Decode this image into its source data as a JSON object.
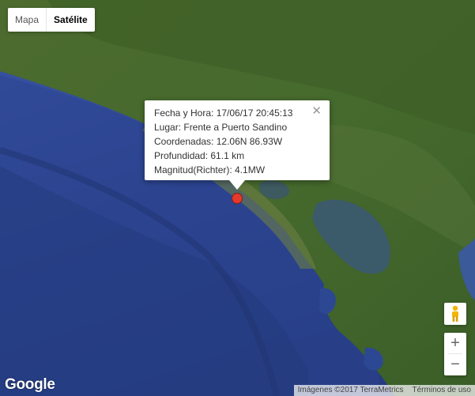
{
  "map_type_control": {
    "options": [
      "Mapa",
      "Satélite"
    ],
    "selected": "Satélite"
  },
  "info_window": {
    "lines": [
      "Fecha y Hora: 17/06/17 20:45:13",
      "Lugar: Frente a Puerto Sandino",
      "Coordenadas: 12.06N 86.93W",
      "Profundidad: 61.1 km",
      "Magnitud(Richter): 4.1MW"
    ],
    "close_symbol": "✕"
  },
  "marker": {
    "color": "#e33a2e",
    "icon": "pin-icon"
  },
  "controls": {
    "pegman_icon": "pegman-icon",
    "zoom_in": "+",
    "zoom_out": "−"
  },
  "footer": {
    "logo": "Google",
    "attribution": "Imágenes ©2017 TerraMetrics",
    "terms": "Términos de uso"
  }
}
